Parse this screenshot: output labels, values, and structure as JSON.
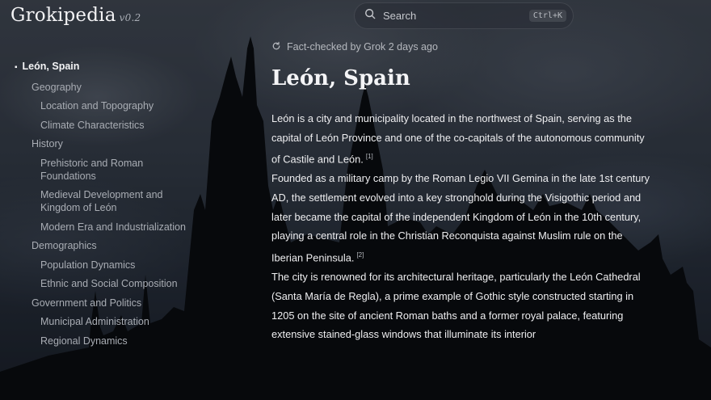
{
  "header": {
    "logo": "Grokipedia",
    "version": "v0.2",
    "search": {
      "placeholder": "Search",
      "shortcut": "Ctrl+K",
      "icon": "search-icon"
    }
  },
  "toc": {
    "items": [
      {
        "label": "León, Spain",
        "level": 0
      },
      {
        "label": "Geography",
        "level": 1
      },
      {
        "label": "Location and Topography",
        "level": 2
      },
      {
        "label": "Climate Characteristics",
        "level": 2
      },
      {
        "label": "History",
        "level": 1
      },
      {
        "label": "Prehistoric and Roman Foundations",
        "level": 2
      },
      {
        "label": "Medieval Development and Kingdom of León",
        "level": 2
      },
      {
        "label": "Modern Era and Industrialization",
        "level": 2
      },
      {
        "label": "Demographics",
        "level": 1
      },
      {
        "label": "Population Dynamics",
        "level": 2
      },
      {
        "label": "Ethnic and Social Composition",
        "level": 2
      },
      {
        "label": "Government and Politics",
        "level": 1
      },
      {
        "label": "Municipal Administration",
        "level": 2
      },
      {
        "label": "Regional Dynamics",
        "level": 2
      }
    ]
  },
  "article": {
    "fact_check": "Fact-checked by Grok 2 days ago",
    "title": "León, Spain",
    "paragraphs": [
      {
        "text": "León is a city and municipality located in the northwest of Spain, serving as the capital of León Province and one of the co-capitals of the autonomous community of Castile and León.",
        "cite": "[1]"
      },
      {
        "text": "Founded as a military camp by the Roman Legio VII Gemina in the late 1st century AD, the settlement evolved into a key stronghold during the Visigothic period and later became the capital of the independent Kingdom of León in the 10th century, playing a central role in the Christian Reconquista against Muslim rule on the Iberian Peninsula.",
        "cite": "[2]"
      },
      {
        "text": "The city is renowned for its architectural heritage, particularly the León Cathedral (Santa María de Regla), a prime example of Gothic style constructed starting in 1205 on the site of ancient Roman baths and a former royal palace, featuring extensive stained-glass windows that illuminate its interior",
        "cite": ""
      }
    ]
  },
  "colors": {
    "text": "#eeeef0",
    "muted": "#a9adb4",
    "overlay": "rgba(0,0,0,0.35)"
  }
}
